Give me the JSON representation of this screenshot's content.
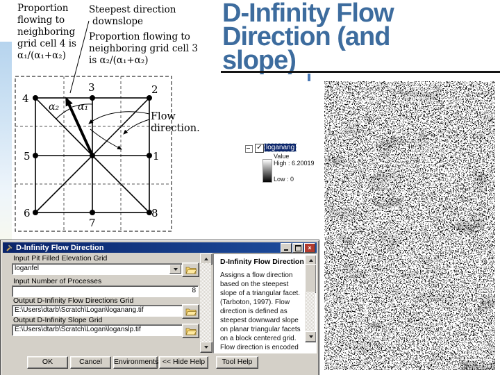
{
  "slide": {
    "title_lines": [
      "D-Infinity Flow",
      "Direction (and",
      "slope)"
    ],
    "title_color": "#3d6c9e"
  },
  "diagram": {
    "prop_cell4_lines": [
      "Proportion",
      "flowing to",
      "neighboring",
      "grid cell 4 is",
      "α₁/(α₁+α₂)"
    ],
    "steepest_lines": [
      "Steepest direction",
      "downslope"
    ],
    "prop_cell3_lines": [
      "Proportion flowing to",
      "neighboring grid cell 3",
      "is α₂/(α₁+α₂)"
    ],
    "flow_direction_lines": [
      "Flow",
      "direction."
    ],
    "alpha1": "α₁",
    "alpha2": "α₂",
    "nodes": {
      "n1": "1",
      "n2": "2",
      "n3": "3",
      "n4": "4",
      "n5": "5",
      "n6": "6",
      "n7": "7",
      "n8": "8"
    }
  },
  "legend": {
    "layer_name": "loganang",
    "value_label": "Value",
    "high_label": "High : 6.20019",
    "low_label": "Low : 0"
  },
  "dialog": {
    "title": "D-Infinity Flow Direction",
    "fields": [
      {
        "label": "Input Pit Filled Elevation Grid",
        "value": "loganfel"
      },
      {
        "label": "Input Number of Processes",
        "value": "8"
      },
      {
        "label": "Output D-Infinity Flow Directions Grid",
        "value": "E:\\Users\\dtarb\\Scratch\\Logan\\loganang.tif"
      },
      {
        "label": "Output D-Infinity Slope Grid",
        "value": "E:\\Users\\dtarb\\Scratch\\Logan\\loganslp.tif"
      }
    ],
    "buttons": {
      "ok": "OK",
      "cancel": "Cancel",
      "environments": "Environments...",
      "hide_help": "<< Hide Help",
      "tool_help": "Tool Help"
    },
    "help": {
      "heading": "D-Infinity Flow Direction",
      "lines": [
        "Assigns a flow direction",
        "based on the steepest",
        "slope of a triangular facet.",
        "(Tarboton, 1997). Flow",
        "direction is defined as",
        "steepest downward slope",
        "on planar triangular facets",
        "on a block centered grid.",
        "Flow direction is encoded"
      ]
    }
  },
  "icons": {
    "close": "×",
    "check": "✓"
  },
  "colors": {
    "titlebar": "#0a246a",
    "selection": "#0a246a",
    "dialog_bg": "#d4d0c8",
    "title_text": "#3d6c9e"
  }
}
